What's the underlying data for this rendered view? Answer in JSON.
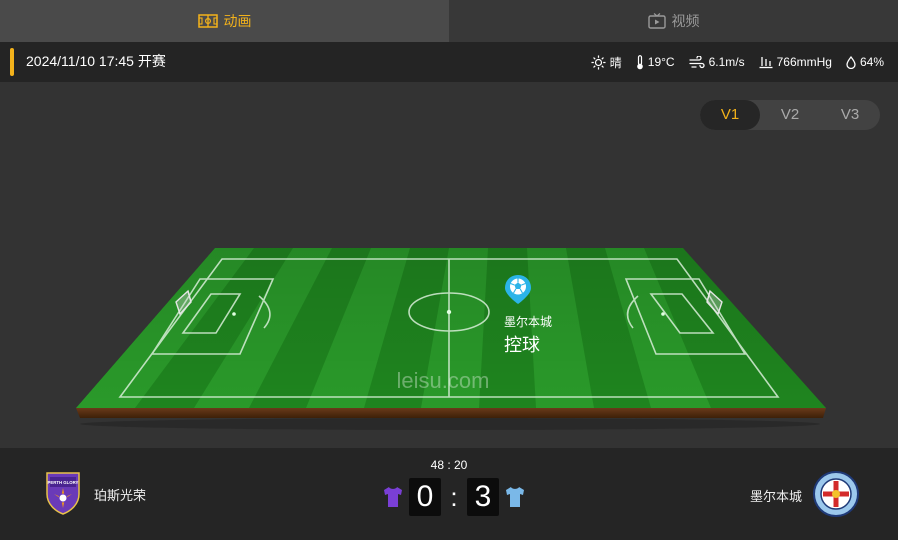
{
  "tabs": [
    {
      "label": "动画",
      "icon": "field-icon",
      "active": true
    },
    {
      "label": "视频",
      "icon": "tv-icon",
      "active": false
    }
  ],
  "match": {
    "datetime": "2024/11/10 17:45 开赛"
  },
  "weather": {
    "condition": "晴",
    "temperature": "19°C",
    "wind": "6.1m/s",
    "pressure": "766mmHg",
    "humidity": "64%"
  },
  "versions": [
    "V1",
    "V2",
    "V3"
  ],
  "active_version": "V1",
  "pitch": {
    "watermark": "leisu.com",
    "possession_team": "墨尔本城",
    "possession_label": "控球"
  },
  "score": {
    "clock": "48 : 20",
    "home": "0",
    "away": "3"
  },
  "teams": {
    "home": {
      "name": "珀斯光荣",
      "crest_text": "PERTH GLORY",
      "jersey_color": "#7a3fd6"
    },
    "away": {
      "name": "墨尔本城",
      "jersey_color": "#7ab8e8"
    }
  },
  "colors": {
    "accent": "#f3b21b",
    "grass_dark": "#1c7a1c",
    "grass_light": "#2a9a2a",
    "marker": "#2bb4e8"
  }
}
